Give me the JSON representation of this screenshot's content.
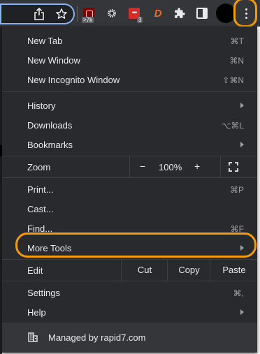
{
  "toolbar": {
    "ublock_badge": ">7k",
    "lastpass_badge": "3",
    "rapid7_glyph": "D",
    "icons": [
      "share-icon",
      "star-icon",
      "ublock-icon",
      "gear-icon",
      "lastpass-icon",
      "rapid7-icon",
      "puzzle-icon",
      "side-panel-icon",
      "kebab-menu-icon"
    ]
  },
  "menu": {
    "new_tab": {
      "label": "New Tab",
      "accel": "⌘T"
    },
    "new_window": {
      "label": "New Window",
      "accel": "⌘N"
    },
    "new_incognito": {
      "label": "New Incognito Window",
      "accel": "⇧⌘N"
    },
    "history": {
      "label": "History"
    },
    "downloads": {
      "label": "Downloads",
      "accel": "⌥⌘L"
    },
    "bookmarks": {
      "label": "Bookmarks"
    },
    "zoom": {
      "label": "Zoom",
      "minus": "−",
      "value": "100%",
      "plus": "+"
    },
    "print": {
      "label": "Print...",
      "accel": "⌘P"
    },
    "cast": {
      "label": "Cast..."
    },
    "find": {
      "label": "Find...",
      "accel": "⌘F"
    },
    "more_tools": {
      "label": "More Tools"
    },
    "edit": {
      "label": "Edit",
      "cut": "Cut",
      "copy": "Copy",
      "paste": "Paste"
    },
    "settings": {
      "label": "Settings",
      "accel": "⌘,"
    },
    "help": {
      "label": "Help"
    },
    "managed": {
      "label": "Managed by rapid7.com"
    }
  },
  "colors": {
    "menu_bg": "#292a2d",
    "footer_bg": "#35363a",
    "highlight": "#f49b0b",
    "text": "#e8eaed",
    "muted": "#9aa0a6"
  }
}
